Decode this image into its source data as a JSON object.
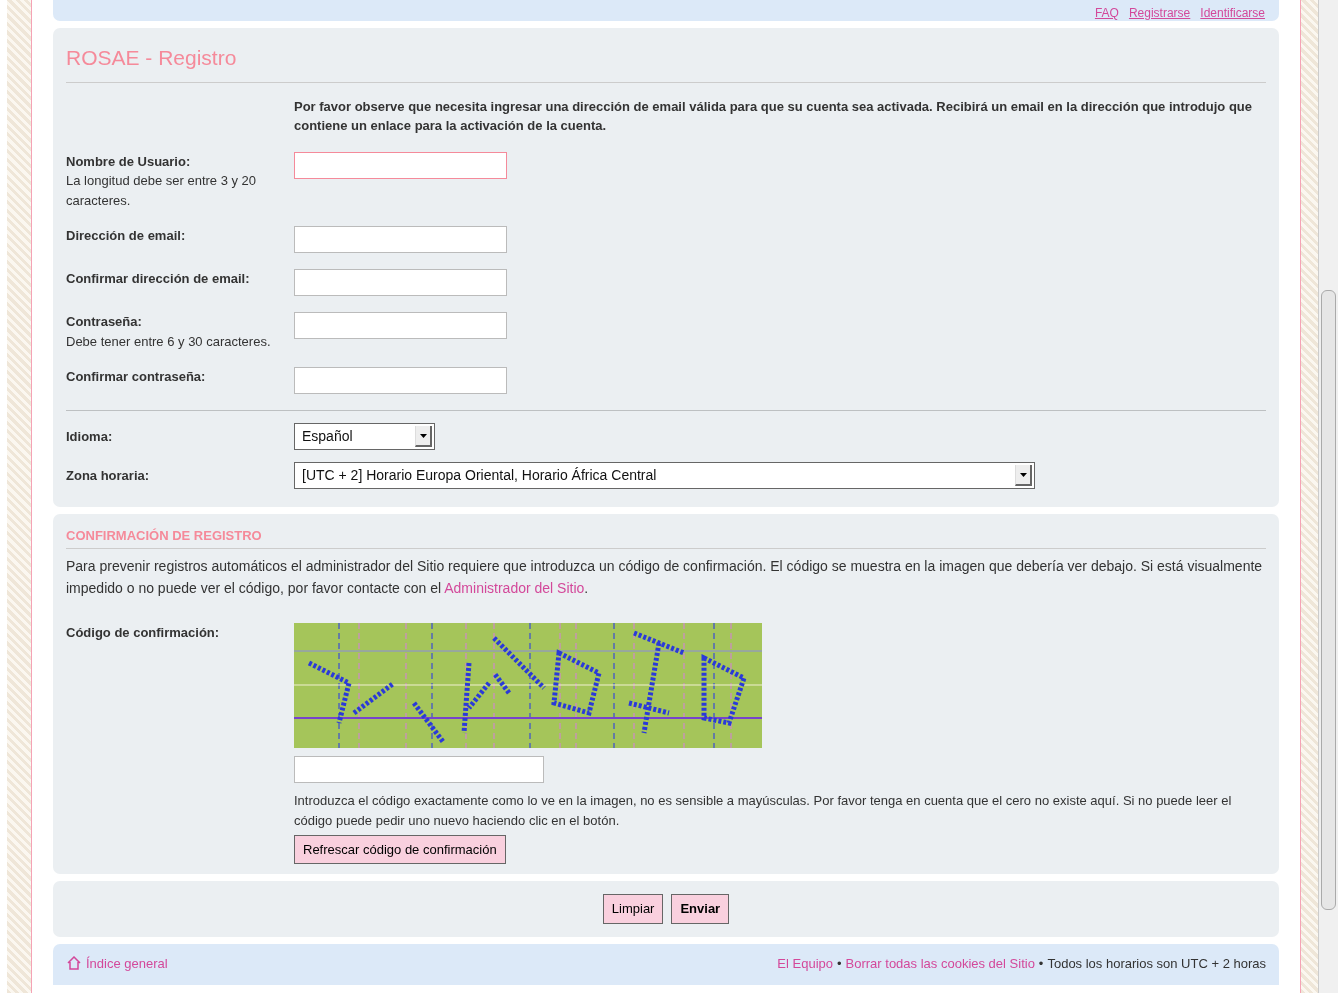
{
  "header_links": [
    {
      "label": "FAQ"
    },
    {
      "label": "Registrarse"
    },
    {
      "label": "Identificarse"
    }
  ],
  "title": "ROSAE - Registro",
  "notice": "Por favor observe que necesita ingresar una dirección de email válida para que su cuenta sea activada. Recibirá un email en la dirección que introdujo que contiene un enlace para la activación de la cuenta.",
  "fields": [
    {
      "label": "Nombre de Usuario:",
      "hint": "La longitud debe ser entre 3 y 20 caracteres.",
      "focused": true
    },
    {
      "label": "Dirección de email:",
      "focused": false
    },
    {
      "label": "Confirmar dirección de email:",
      "focused": false
    },
    {
      "label": "Contraseña:",
      "hint": "Debe tener entre 6 y 30 caracteres.",
      "focused": false
    },
    {
      "label": "Confirmar contraseña:",
      "focused": false
    }
  ],
  "selects": [
    {
      "kind": "language",
      "label": "Idioma:",
      "value": "Español"
    },
    {
      "kind": "timezone",
      "label": "Zona horaria:",
      "value": "[UTC + 2] Horario Europa Oriental, Horario África Central"
    }
  ],
  "confirmation": {
    "heading": "CONFIRMACIÓN DE REGISTRO",
    "text": "Para prevenir registros automáticos el administrador del Sitio requiere que introduzca un código de confirmación. El código se muestra en la imagen que debería ver debajo. Si está visualmente impedido o no puede ver el código, por favor contacte con el ",
    "link": "Administrador del Sitio",
    "text_end": ".",
    "code_label": "Código de confirmación:",
    "help": "Introduzca el código exactamente como lo ve en la imagen, no es sensible a mayúsculas. Por favor tenga en cuenta que el cero no existe aquí. Si no puede leer el código puede pedir uno nuevo haciendo clic en el botón.",
    "refresh_button": "Refrescar código de confirmación"
  },
  "buttons": [
    {
      "kind": "reset",
      "label": "Limpiar"
    },
    {
      "kind": "submit",
      "label": "Enviar"
    }
  ],
  "footer": {
    "home_link": "Índice general",
    "right": [
      {
        "kind": "link",
        "text": "El Equipo"
      },
      {
        "kind": "sep",
        "text": "•"
      },
      {
        "kind": "link",
        "text": "Borrar todas las cookies del Sitio"
      },
      {
        "kind": "sep",
        "text": "•"
      },
      {
        "kind": "text",
        "text": "Todos los horarios son UTC + 2 horas"
      }
    ]
  }
}
